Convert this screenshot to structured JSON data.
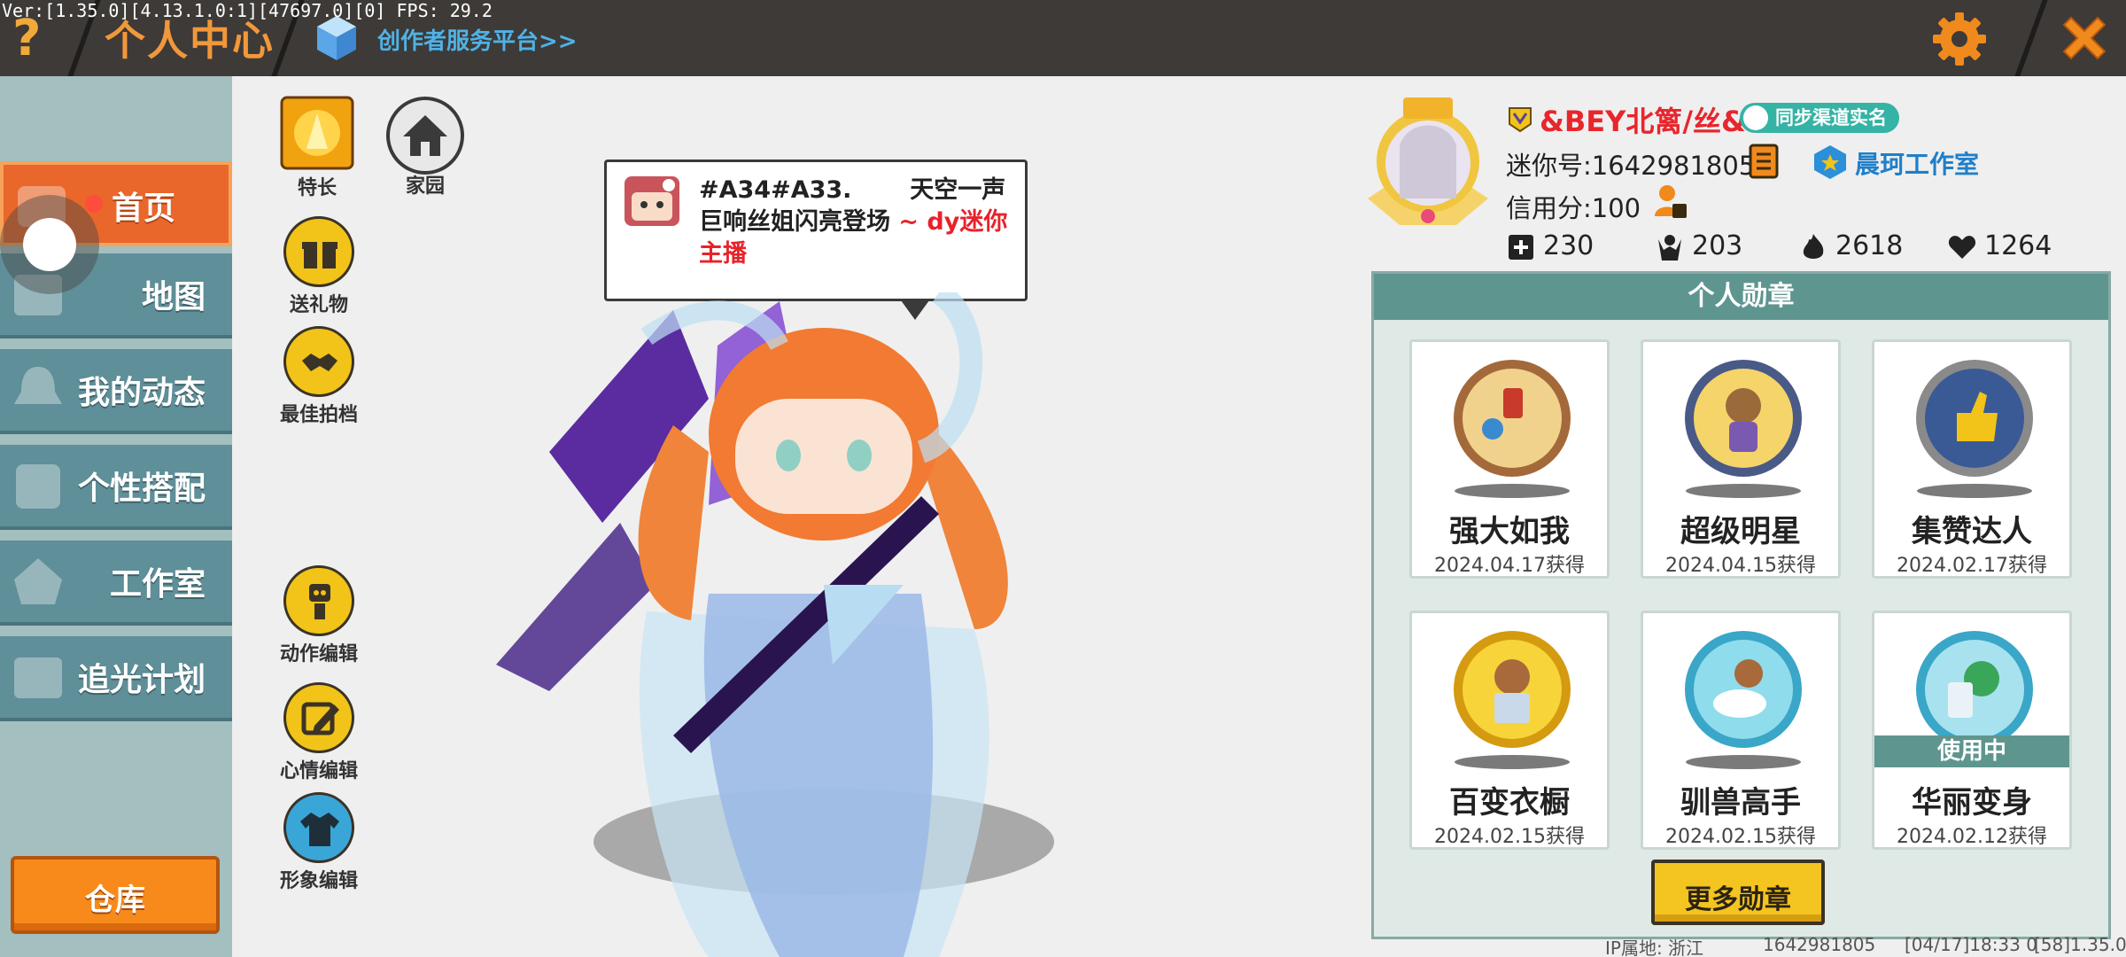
{
  "debug_info": "Ver:[1.35.0][4.13.1.0:1][47697.0][0] FPS: 29.2",
  "header": {
    "title": "个人中心",
    "creator_link": "创作者服务平台>>"
  },
  "sidebar": {
    "items": [
      {
        "label": "首页",
        "active": true
      },
      {
        "label": "地图"
      },
      {
        "label": "我的动态"
      },
      {
        "label": "个性搭配"
      },
      {
        "label": "工作室"
      },
      {
        "label": "追光计划"
      }
    ],
    "warehouse": "仓库"
  },
  "tools": {
    "specialty": "特长",
    "home": "家园",
    "gift": "送礼物",
    "best_photo": "最佳拍档",
    "action_edit": "动作编辑",
    "mood_edit": "心情编辑",
    "image_edit": "形象编辑"
  },
  "bubble": {
    "text": "#A34#A33.       天空一声巨响丝姐闪亮登场",
    "highlight": "~ dy迷你主播"
  },
  "profile": {
    "username": "&BEY北篱/丝&",
    "realname_badge": "同步渠道实名",
    "mini_id": "迷你号:1642981805",
    "studio": "晨珂工作室",
    "credit": "信用分:100",
    "stats": {
      "collections": "230",
      "followers": "203",
      "popularity": "2618",
      "likes": "1264"
    }
  },
  "medals": {
    "header": "个人勋章",
    "items": [
      {
        "name": "强大如我",
        "date": "2024.04.17获得"
      },
      {
        "name": "超级明星",
        "date": "2024.04.15获得"
      },
      {
        "name": "集赞达人",
        "date": "2024.02.17获得"
      },
      {
        "name": "百变衣橱",
        "date": "2024.02.15获得"
      },
      {
        "name": "驯兽高手",
        "date": "2024.02.15获得"
      },
      {
        "name": "华丽变身",
        "date": "2024.02.12获得",
        "in_use": "使用中"
      }
    ],
    "more_button": "更多勋章"
  },
  "footer": {
    "ip": "IP属地: 浙江",
    "id": "1642981805",
    "session": "[04/17]18:33 0",
    "version": "[58]1.35.0"
  },
  "colors": {
    "topbar": "#3d3a37",
    "title": "#f2973b",
    "sidebar_item": "#5f8f98",
    "sidebar_active": "#e9672a",
    "medal_header": "#5e968f",
    "username": "#e8262c",
    "studio": "#1f7fc9"
  }
}
